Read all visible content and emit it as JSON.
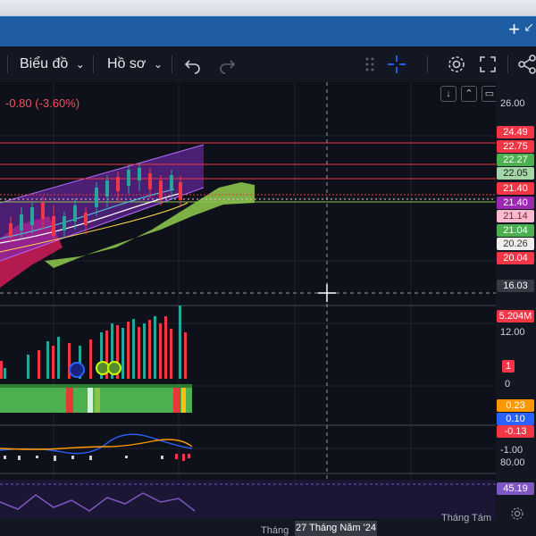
{
  "toolbar": {
    "chart_menu": "Biểu đồ",
    "profile_menu": "Hồ sơ"
  },
  "chart": {
    "change_text": "-0.80 (-3.60%)"
  },
  "price_scale": {
    "top_tick": "26.00",
    "labels": [
      {
        "text": "24.49",
        "bg": "#f23645",
        "fg": "#ffffff"
      },
      {
        "text": "22.75",
        "bg": "#f23645",
        "fg": "#ffffff"
      },
      {
        "text": "22.27",
        "bg": "#4caf50",
        "fg": "#ffffff"
      },
      {
        "text": "22.05",
        "bg": "#a5d6a7",
        "fg": "#1b1b1b"
      },
      {
        "text": "21.40",
        "bg": "#f23645",
        "fg": "#ffffff"
      },
      {
        "text": "21.40",
        "bg": "#9c27b0",
        "fg": "#ffffff"
      },
      {
        "text": "21.14",
        "bg": "#f8bbd0",
        "fg": "#7a1f2a"
      },
      {
        "text": "21.04",
        "bg": "#4caf50",
        "fg": "#ffffff"
      },
      {
        "text": "20.26",
        "bg": "#eeeeee",
        "fg": "#333333"
      },
      {
        "text": "20.04",
        "bg": "#f23645",
        "fg": "#ffffff"
      }
    ],
    "crosshair_price": "16.03",
    "volume_label": "5.204M",
    "vol_tick": "12.00",
    "indicator_badge": "1",
    "zero_tick": "0",
    "macd_labels": [
      {
        "text": "0.23",
        "bg": "#ff9800",
        "fg": "#ffffff"
      },
      {
        "text": "0.10",
        "bg": "#2962ff",
        "fg": "#ffffff"
      },
      {
        "text": "-0.13",
        "bg": "#f23645",
        "fg": "#ffffff"
      }
    ],
    "macd_tick": "-1.00",
    "rsi_top_tick": "80.00",
    "rsi_label": "45.19"
  },
  "time_axis": {
    "month_partial": "Tháng",
    "crosshair_date": "27 Tháng Năm '24",
    "month_august": "Tháng Tám"
  },
  "colors": {
    "accent_blue": "#1f5da3",
    "bull": "#26a69a",
    "bear": "#f23645",
    "cloud": "#8bc34a",
    "channel": "#9c27b0"
  }
}
